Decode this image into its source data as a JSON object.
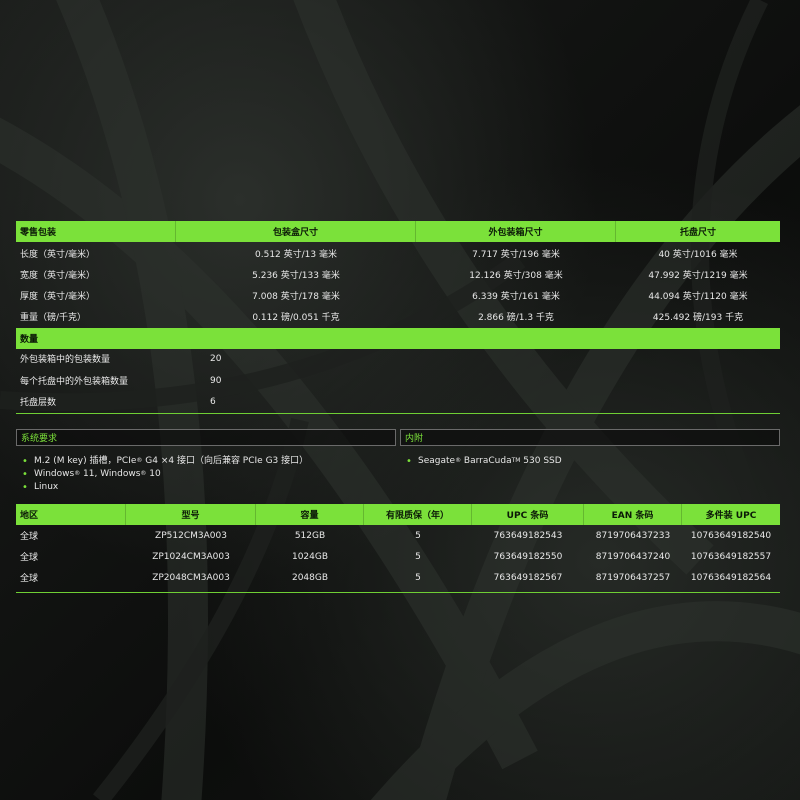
{
  "colors": {
    "accent": "#7be13a",
    "background": "#0b0c0b",
    "text": "#e6e6e6"
  },
  "packaging": {
    "headers": [
      "零售包装",
      "包装盒尺寸",
      "外包装箱尺寸",
      "托盘尺寸"
    ],
    "rows": [
      [
        "长度（英寸/毫米）",
        "0.512 英寸/13 毫米",
        "7.717 英寸/196 毫米",
        "40 英寸/1016 毫米"
      ],
      [
        "宽度（英寸/毫米）",
        "5.236 英寸/133 毫米",
        "12.126 英寸/308 毫米",
        "47.992 英寸/1219 毫米"
      ],
      [
        "厚度（英寸/毫米）",
        "7.008 英寸/178 毫米",
        "6.339 英寸/161 毫米",
        "44.094 英寸/1120 毫米"
      ],
      [
        "重量（磅/千克）",
        "0.112 磅/0.051 千克",
        "2.866 磅/1.3 千克",
        "425.492 磅/193 千克"
      ]
    ]
  },
  "quantity": {
    "header": "数量",
    "rows": [
      [
        "外包装箱中的包装数量",
        "20"
      ],
      [
        "每个托盘中的外包装箱数量",
        "90"
      ],
      [
        "托盘层数",
        "6"
      ]
    ]
  },
  "requirements": {
    "title": "系统要求",
    "items": [
      {
        "before": "M.2 (M key) 插槽，PCIe",
        "sup": "®",
        "after": " G4 ×4 接口（向后兼容 PCIe G3 接口）"
      },
      {
        "before": "Windows",
        "sup": "®",
        "mid": " 11, Windows",
        "sup2": "®",
        "after": " 10"
      },
      {
        "before": "Linux"
      }
    ]
  },
  "contents": {
    "title": "内附",
    "items": [
      {
        "before": "Seagate",
        "sup": "®",
        "mid": " BarraCuda",
        "sup2": "TM",
        "after": " 530 SSD"
      }
    ]
  },
  "models": {
    "headers": [
      "地区",
      "型号",
      "容量",
      "有限质保（年）",
      "UPC 条码",
      "EAN 条码",
      "多件装 UPC"
    ],
    "rows": [
      [
        "全球",
        "ZP512CM3A003",
        "512GB",
        "5",
        "763649182543",
        "8719706437233",
        "10763649182540"
      ],
      [
        "全球",
        "ZP1024CM3A003",
        "1024GB",
        "5",
        "763649182550",
        "8719706437240",
        "10763649182557"
      ],
      [
        "全球",
        "ZP2048CM3A003",
        "2048GB",
        "5",
        "763649182567",
        "8719706437257",
        "10763649182564"
      ]
    ]
  }
}
